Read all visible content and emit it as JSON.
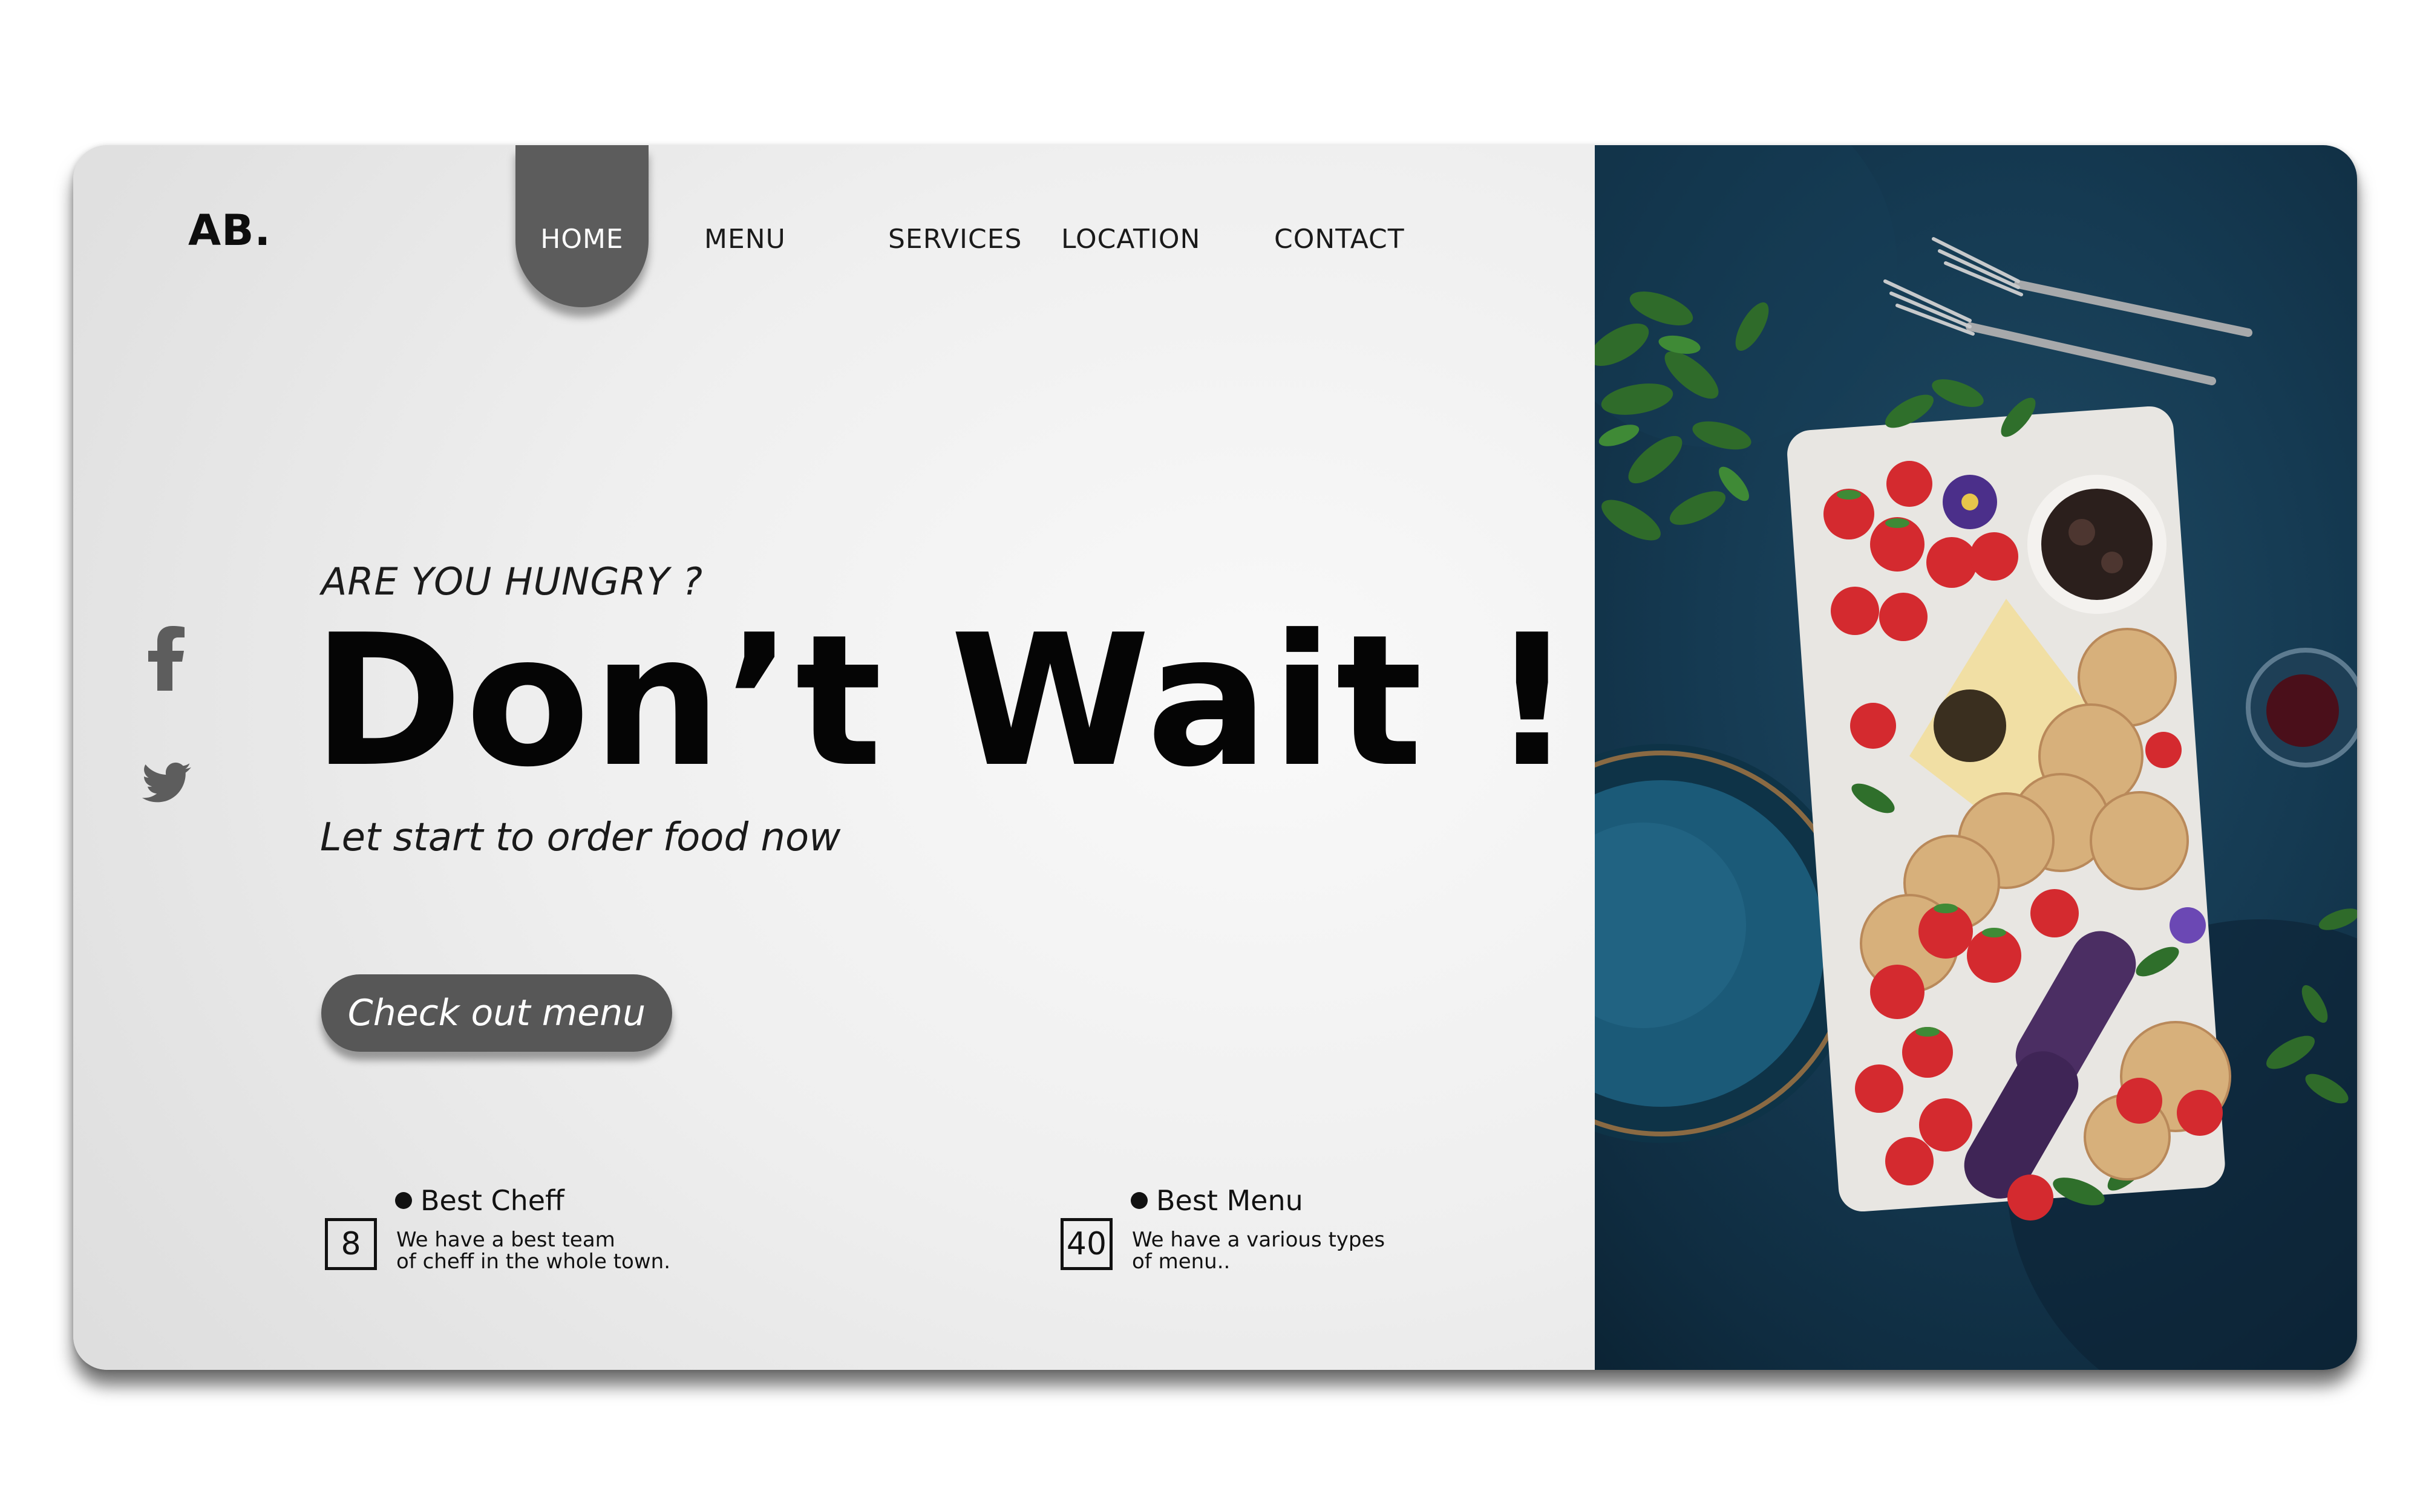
{
  "brand": {
    "logo": "AB."
  },
  "nav": {
    "items": [
      {
        "label": "HOME",
        "active": true
      },
      {
        "label": "MENU"
      },
      {
        "label": "SERVICES"
      },
      {
        "label": "LOCATION"
      },
      {
        "label": "CONTACT"
      }
    ]
  },
  "social": {
    "icons": [
      "facebook-icon",
      "twitter-icon"
    ]
  },
  "hero": {
    "eyebrow": "ARE YOU HUNGRY ?",
    "headline": "Don’t Wait !",
    "subhead": "Let start to order food now",
    "cta_label": "Check out menu"
  },
  "stats": [
    {
      "title": "Best Cheff",
      "number": "8",
      "desc_line1": "We have a best team",
      "desc_line2": "of cheff in the whole town."
    },
    {
      "title": "Best Menu",
      "number": "40",
      "desc_line1": "We have a various types",
      "desc_line2": "of menu.."
    }
  ],
  "image": {
    "icon": "menu-icon"
  },
  "colors": {
    "accent_gray": "#575757",
    "text_dark": "#050505",
    "panel_blue": "#153a52"
  }
}
